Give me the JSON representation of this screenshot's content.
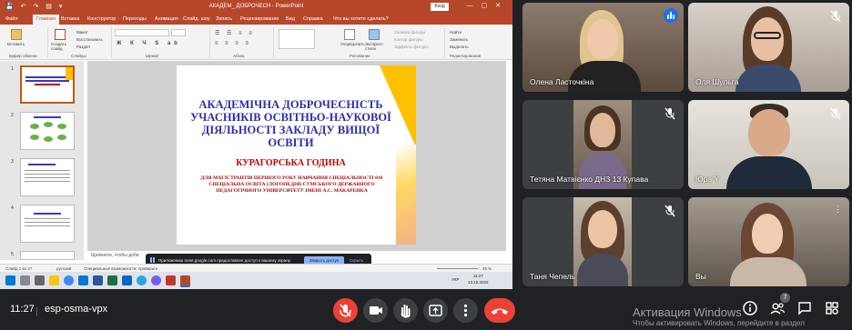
{
  "ppt": {
    "title": "АКАДЕМ_ ДОБРОЧЕСН - PowerPoint",
    "qat": "💾 ↶ ↷ ▤ ▾",
    "login_label": "Вход",
    "tabs": [
      "Файл",
      "Главная",
      "Вставка",
      "Конструктор",
      "Переходы",
      "Анимация",
      "Слайд. шоу",
      "Запись",
      "Рецензирование",
      "Вид",
      "Справка",
      "Что вы хотите сделать?"
    ],
    "ribbon": {
      "clipboard": "Буфер обмена",
      "paste": "Вставить",
      "slides": "Слайды",
      "new_slide": "Создать слайд",
      "layout": "Макет",
      "reset": "Восстановить",
      "section": "Раздел",
      "font": "Шрифт",
      "paragraph": "Абзац",
      "drawing": "Рисование",
      "arrange": "Упорядочить",
      "quick_styles": "Экспресс-стили",
      "shape_fill": "Заливка фигуры",
      "shape_outline": "Контур фигуры",
      "shape_effects": "Эффекты фигуры",
      "editing": "Редактирование",
      "find": "Найти",
      "replace": "Заменить",
      "select": "Выделить"
    },
    "slide": {
      "title": "АКАДЕМІЧНА ДОБРОЧЕСНІСТЬ УЧАСНИКІВ ОСВІТНЬО-НАУКОВОЇ ДІЯЛЬНОСТІ ЗАКЛАДУ ВИЩОЇ ОСВІТИ",
      "subtitle": "КУРАГОРСЬКА ГОДИНА",
      "body": "ДЛЯ МАГІСТРАНТІВ ПЕРШОГО РОКУ НАВЧАННЯ СПЕЦІАЛЬНОСТІ 016 СПЕЦІАЛЬНА ОСВІТА (ЛОГОПЕДІЯ) СУМСЬКОГО ДЕРЖАВНОГО ПЕДАГОГІЧНОГО УНІВЕРСИТЕТУ ІМЕНІ А.С. МАКАРЕНКА"
    },
    "thumb_numbers": [
      "1",
      "2",
      "3",
      "4",
      "5"
    ],
    "notes_placeholder": "Щелкните, чтобы доба",
    "share_message": "Приложению meet.google.com предоставлен доступ к вашему экрану.",
    "stop_sharing": "Закрыть доступ",
    "hide": "Скрыть",
    "status": {
      "slide": "Слайд 1 из 27",
      "lang": "русский",
      "accessibility": "Специальные возможности: проверьте",
      "zoom": "46 %",
      "time": "11:27",
      "date": "13.10.2022",
      "kbd": "УКР"
    },
    "colors": {
      "titlebar": "#b7472a",
      "slide_title": "#2e2ea8",
      "slide_accent": "#c00000"
    }
  },
  "participants": [
    {
      "name": "Олена Ласточкіна",
      "speaking": true
    },
    {
      "name": "Оля Шульга",
      "muted": true
    },
    {
      "name": "Тетяна Матвієнко ДНЗ 13 Купава",
      "muted": true
    },
    {
      "name": "Юра Y",
      "muted": true
    },
    {
      "name": "Таня Чепель",
      "muted": true
    },
    {
      "name": "Вы",
      "muted": false
    }
  ],
  "bottom": {
    "time": "11:27",
    "meeting_code": "esp-osma-vpx",
    "activation_title": "Активация Windows",
    "activation_sub": "Чтобы активировать Windows, перейдите в раздел",
    "people_count": "7",
    "icons": [
      "mic-off-icon",
      "camera-icon",
      "raise-hand-icon",
      "present-icon",
      "more-icon",
      "hangup-icon",
      "info-icon",
      "people-icon",
      "chat-icon",
      "activities-icon"
    ]
  }
}
